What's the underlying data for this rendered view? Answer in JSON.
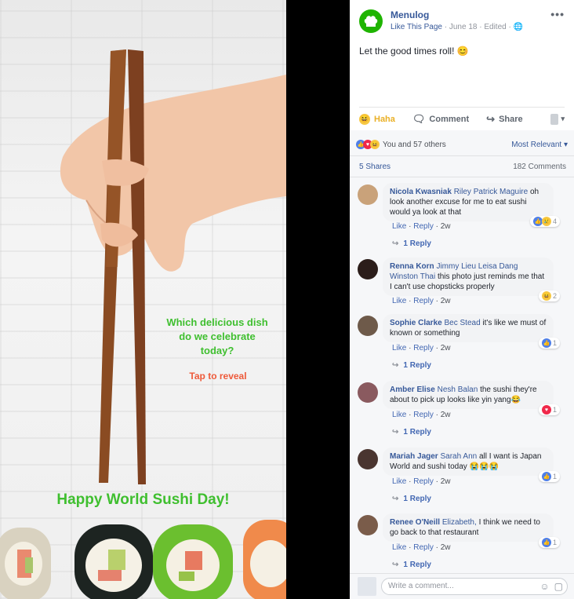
{
  "promo": {
    "question": "Which delicious dish do we celebrate today?",
    "tap": "Tap to reveal",
    "title": "Happy World Sushi Day!"
  },
  "post": {
    "page_name": "Menulog",
    "like_page": "Like This Page",
    "date": "June 18",
    "edited": "Edited",
    "text": "Let the good times roll! 😊",
    "more": "•••",
    "actions": {
      "haha": "Haha",
      "comment": "Comment",
      "share": "Share"
    },
    "reactions_text": "You and 57 others",
    "sort": "Most Relevant ▾",
    "shares": "5 Shares",
    "comments_count": "182 Comments"
  },
  "comments": [
    {
      "name": "Nicola Kwasniak",
      "tag": "Riley Patrick Maguire",
      "text": "oh look another excuse for me to eat sushi would ya look at that",
      "like": "Like",
      "reply": "Reply",
      "time": "2w",
      "react_count": "4",
      "replies": "1 Reply",
      "avatar_color": "#c9a27a"
    },
    {
      "name": "Renna Korn",
      "tag": "Jimmy Lieu Leisa Dang Winston Thai",
      "text": "this photo just reminds me that I can't use chopsticks properly",
      "like": "Like",
      "reply": "Reply",
      "time": "2w",
      "react_count": "2",
      "replies": "",
      "avatar_color": "#2b1d1a"
    },
    {
      "name": "Sophie Clarke",
      "tag": "Bec Stead",
      "text": "it's like we must of known or something",
      "like": "Like",
      "reply": "Reply",
      "time": "2w",
      "react_count": "1",
      "replies": "1 Reply",
      "avatar_color": "#6e5a4a"
    },
    {
      "name": "Amber Elise",
      "tag": "Nesh Balan",
      "text": "the sushi they're about to pick up looks like yin yang😂",
      "like": "Like",
      "reply": "Reply",
      "time": "2w",
      "react_count": "1",
      "replies": "1 Reply",
      "avatar_color": "#8a5a5f"
    },
    {
      "name": "Mariah Jager",
      "tag": "Sarah Ann",
      "text": "all I want is Japan World and sushi today 😭😭😭",
      "like": "Like",
      "reply": "Reply",
      "time": "2w",
      "react_count": "1",
      "replies": "1 Reply",
      "avatar_color": "#4a3530"
    },
    {
      "name": "Renee O'Neill",
      "tag": "Elizabeth,",
      "text": "I think we need to go back to that restaurant",
      "like": "Like",
      "reply": "Reply",
      "time": "2w",
      "react_count": "1",
      "replies": "1 Reply",
      "avatar_color": "#7a5c4a"
    }
  ],
  "write": {
    "placeholder": "Write a comment..."
  }
}
